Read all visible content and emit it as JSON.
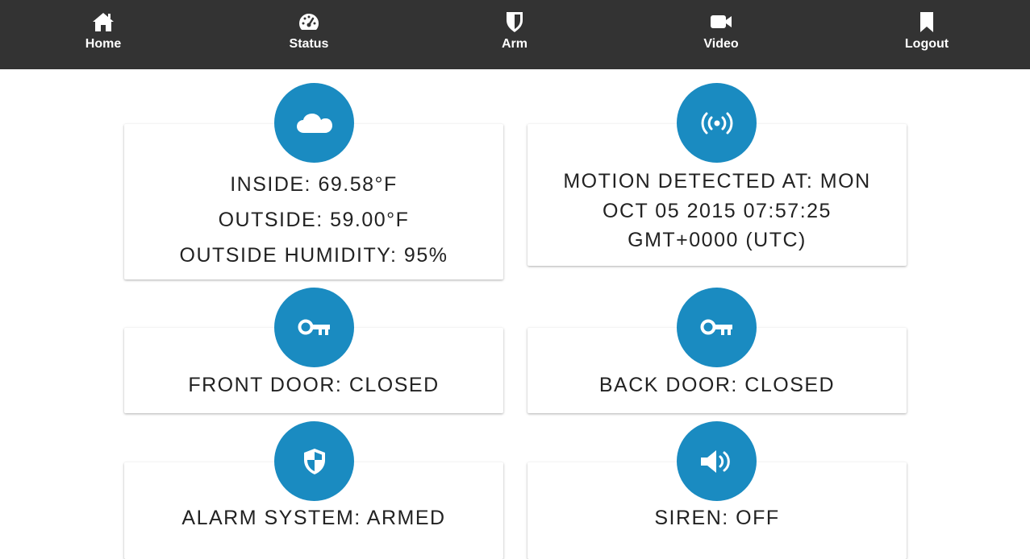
{
  "nav": {
    "items": [
      {
        "label": "Home",
        "icon": "home-icon"
      },
      {
        "label": "Status",
        "icon": "dashboard-icon"
      },
      {
        "label": "Arm",
        "icon": "shield-icon"
      },
      {
        "label": "Video",
        "icon": "video-camera-icon"
      },
      {
        "label": "Logout",
        "icon": "bookmark-icon"
      }
    ]
  },
  "colors": {
    "navbar": "#333333",
    "accent": "#1a8bc1",
    "text": "#222222"
  },
  "cards": {
    "weather": {
      "icon": "cloud-icon",
      "lines": [
        "INSIDE: 69.58°F",
        "OUTSIDE: 59.00°F",
        "OUTSIDE HUMIDITY: 95%"
      ]
    },
    "motion": {
      "icon": "broadcast-icon",
      "lines": [
        "MOTION DETECTED AT: MON",
        "OCT 05 2015 07:57:25",
        "GMT+0000 (UTC)"
      ]
    },
    "front_door": {
      "icon": "key-icon",
      "text": "FRONT DOOR: CLOSED"
    },
    "back_door": {
      "icon": "key-icon",
      "text": "BACK DOOR: CLOSED"
    },
    "alarm": {
      "icon": "shield-half-icon",
      "text": "ALARM SYSTEM: ARMED"
    },
    "siren": {
      "icon": "speaker-icon",
      "text": "SIREN: OFF"
    }
  }
}
